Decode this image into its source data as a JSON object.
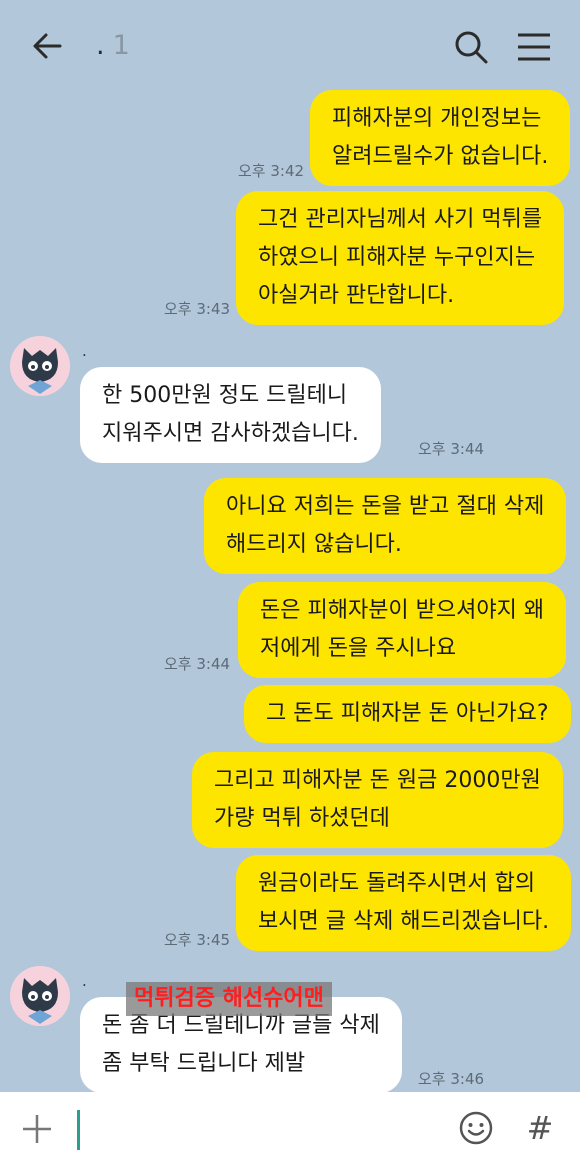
{
  "header": {
    "title": ".",
    "member_count": "1",
    "icons": {
      "back": "arrow-left-icon",
      "search": "search-icon",
      "menu": "hamburger-menu-icon"
    }
  },
  "colors": {
    "background": "#b2c7d9",
    "my_bubble": "#fee500",
    "their_bubble": "#ffffff",
    "watermark_text": "#ff1e1e"
  },
  "messages": [
    {
      "from": "me",
      "lines": [
        "피해자분의 개인정보는",
        "알려드릴수가 없습니다."
      ],
      "time": "오후 3:42"
    },
    {
      "from": "me",
      "lines": [
        "그건 관리자님께서 사기 먹튀를",
        "하였으니 피해자분 누구인지는",
        "아실거라 판단합니다."
      ],
      "time": "오후 3:43"
    },
    {
      "from": "them",
      "sender": ".",
      "lines": [
        "한 500만원 정도 드릴테니",
        "지워주시면 감사하겠습니다."
      ],
      "time": "오후 3:44"
    },
    {
      "from": "me",
      "lines": [
        "아니요 저희는 돈을 받고 절대 삭제",
        "해드리지 않습니다."
      ],
      "time": ""
    },
    {
      "from": "me",
      "lines": [
        "돈은 피해자분이 받으셔야지 왜",
        "저에게 돈을 주시나요"
      ],
      "time": "오후 3:44"
    },
    {
      "from": "me",
      "lines": [
        "그 돈도 피해자분 돈 아닌가요?"
      ],
      "time": ""
    },
    {
      "from": "me",
      "lines": [
        "그리고 피해자분 돈 원금 2000만원",
        "가량 먹튀 하셨던데"
      ],
      "time": ""
    },
    {
      "from": "me",
      "lines": [
        "원금이라도 돌려주시면서 합의",
        "보시면 글 삭제 해드리겠습니다."
      ],
      "time": "오후 3:45"
    },
    {
      "from": "them",
      "sender": ".",
      "lines": [
        "돈 좀 더 드릴테니까 글들 삭제",
        "좀 부탁 드립니다 제발"
      ],
      "time": "오후 3:46"
    }
  ],
  "watermark": "먹튀검증 해선슈어맨",
  "input_bar": {
    "icons": {
      "add": "plus-icon",
      "emoji": "emoji-icon",
      "hashtag": "hash-icon"
    },
    "hashtag_label": "#"
  }
}
